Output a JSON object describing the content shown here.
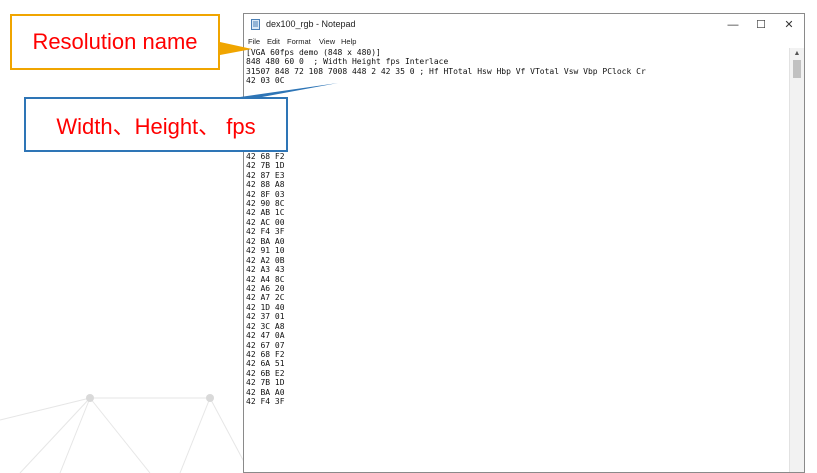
{
  "window": {
    "title": "dex100_rgb - Notepad",
    "controls": {
      "minimize": "—",
      "maximize": "☐",
      "close": "✕"
    }
  },
  "menu": [
    "File",
    "Edit",
    "Format",
    "View",
    "Help"
  ],
  "editor": {
    "lines": [
      "[VGA 60fps demo (848 x 480)]",
      "848 480 60 0  ; Width Height fps Interlace",
      "31507 848 72 108 7008 448 2 42 35 0 ; Hf HTotal Hsw Hbp Vf VTotal Vsw Vbp PClock Cr",
      "42 03 0C",
      "",
      "",
      "",
      "",
      "",
      "",
      "",
      "42 68 F2",
      "42 7B 1D",
      "42 87 E3",
      "42 88 A8",
      "42 8F 03",
      "42 90 8C",
      "42 AB 1C",
      "42 AC 00",
      "42 F4 3F",
      "42 BA A0",
      "42 91 10",
      "42 A2 0B",
      "42 A3 43",
      "42 A4 8C",
      "42 A6 20",
      "42 A7 2C",
      "42 1D 40",
      "42 37 01",
      "42 3C A8",
      "42 47 0A",
      "42 67 07",
      "42 68 F2",
      "42 6A 51",
      "42 6B E2",
      "42 7B 1D",
      "42 BA A0",
      "42 F4 3F"
    ]
  },
  "annotations": {
    "resolution_name": "Resolution name",
    "width_height_fps": "Width、Height、 fps",
    "colors": {
      "resolution_border": "#f0a500",
      "width_border": "#2e75b6",
      "text": "#ff0000"
    }
  }
}
